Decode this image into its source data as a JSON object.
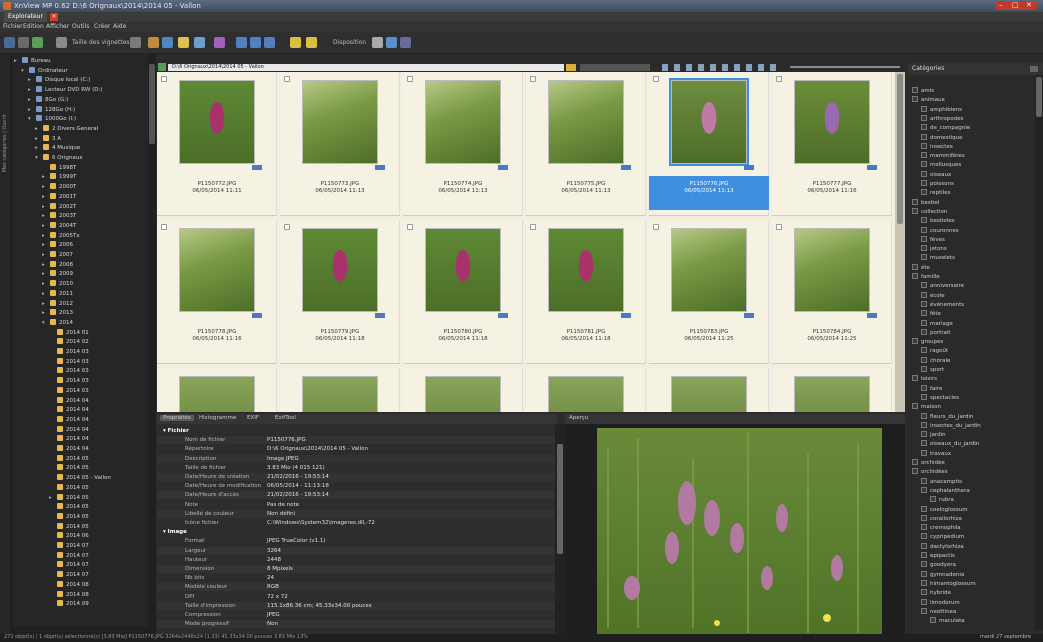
{
  "window": {
    "title": "XnView MP 0.62 D:\\6 Orignaux\\2014\\2014 05 - Vallon"
  },
  "tabs": [
    {
      "label": "Explorateur"
    }
  ],
  "menu": [
    "Fichier",
    "Edition",
    "Afficher",
    "Outils",
    "Créer",
    "Aide"
  ],
  "toolbar": {
    "thumb_size_label": "Taille des vignettes",
    "arrange_label": "Disposition"
  },
  "path": {
    "value": "D:\\6 Orignaux\\2014\\2014 05 - Vallon"
  },
  "side_strip": "Mes catégories | Ouvrir",
  "tree": [
    {
      "label": "Bureau",
      "indent": 0,
      "exp": "▸"
    },
    {
      "label": "Ordinateur",
      "indent": 1,
      "exp": "▾"
    },
    {
      "label": "Disque local (C:)",
      "indent": 2,
      "exp": "▸"
    },
    {
      "label": "Lecteur DVD RW (D:)",
      "indent": 2,
      "exp": "▸"
    },
    {
      "label": "8Go (G:)",
      "indent": 2,
      "exp": "▸"
    },
    {
      "label": "128Go (H:)",
      "indent": 2,
      "exp": "▸"
    },
    {
      "label": "1000Go (I:)",
      "indent": 2,
      "exp": "▾"
    },
    {
      "label": "2 Divers General",
      "indent": 3,
      "exp": "▸"
    },
    {
      "label": "3 A",
      "indent": 3,
      "exp": "▸"
    },
    {
      "label": "4 Musique",
      "indent": 3,
      "exp": "▸"
    },
    {
      "label": "6 Orignaux",
      "indent": 3,
      "exp": "▾"
    },
    {
      "label": "1998T",
      "indent": 4,
      "exp": ""
    },
    {
      "label": "1999T",
      "indent": 4,
      "exp": "▸"
    },
    {
      "label": "2000T",
      "indent": 4,
      "exp": "▸"
    },
    {
      "label": "2001T",
      "indent": 4,
      "exp": "▸"
    },
    {
      "label": "2002T",
      "indent": 4,
      "exp": "▸"
    },
    {
      "label": "2003T",
      "indent": 4,
      "exp": "▸"
    },
    {
      "label": "2004T",
      "indent": 4,
      "exp": "▸"
    },
    {
      "label": "2005Tx",
      "indent": 4,
      "exp": "▸"
    },
    {
      "label": "2006",
      "indent": 4,
      "exp": "▸"
    },
    {
      "label": "2007",
      "indent": 4,
      "exp": "▸"
    },
    {
      "label": "2008",
      "indent": 4,
      "exp": "▸"
    },
    {
      "label": "2009",
      "indent": 4,
      "exp": "▸"
    },
    {
      "label": "2010",
      "indent": 4,
      "exp": "▸"
    },
    {
      "label": "2011",
      "indent": 4,
      "exp": "▸"
    },
    {
      "label": "2012",
      "indent": 4,
      "exp": "▸"
    },
    {
      "label": "2013",
      "indent": 4,
      "exp": "▸"
    },
    {
      "label": "2014",
      "indent": 4,
      "exp": "▾"
    },
    {
      "label": "2014 01",
      "indent": 5,
      "exp": ""
    },
    {
      "label": "2014 02",
      "indent": 5,
      "exp": ""
    },
    {
      "label": "2014 03",
      "indent": 5,
      "exp": ""
    },
    {
      "label": "2014 03",
      "indent": 5,
      "exp": ""
    },
    {
      "label": "2014 03",
      "indent": 5,
      "exp": ""
    },
    {
      "label": "2014 03",
      "indent": 5,
      "exp": ""
    },
    {
      "label": "2014 03",
      "indent": 5,
      "exp": ""
    },
    {
      "label": "2014 04",
      "indent": 5,
      "exp": ""
    },
    {
      "label": "2014 04",
      "indent": 5,
      "exp": ""
    },
    {
      "label": "2014 04",
      "indent": 5,
      "exp": ""
    },
    {
      "label": "2014 04",
      "indent": 5,
      "exp": ""
    },
    {
      "label": "2014 04",
      "indent": 5,
      "exp": ""
    },
    {
      "label": "2014 04",
      "indent": 5,
      "exp": ""
    },
    {
      "label": "2014 05",
      "indent": 5,
      "exp": ""
    },
    {
      "label": "2014 05",
      "indent": 5,
      "exp": ""
    },
    {
      "label": "2014 05 - Vallon",
      "indent": 5,
      "exp": ""
    },
    {
      "label": "2014 05",
      "indent": 5,
      "exp": ""
    },
    {
      "label": "2014 05",
      "indent": 5,
      "exp": "▸"
    },
    {
      "label": "2014 05",
      "indent": 5,
      "exp": ""
    },
    {
      "label": "2014 05",
      "indent": 5,
      "exp": ""
    },
    {
      "label": "2014 05",
      "indent": 5,
      "exp": ""
    },
    {
      "label": "2014 06",
      "indent": 5,
      "exp": ""
    },
    {
      "label": "2014 07",
      "indent": 5,
      "exp": ""
    },
    {
      "label": "2014 07",
      "indent": 5,
      "exp": ""
    },
    {
      "label": "2014 07",
      "indent": 5,
      "exp": ""
    },
    {
      "label": "2014 07",
      "indent": 5,
      "exp": ""
    },
    {
      "label": "2014 08",
      "indent": 5,
      "exp": ""
    },
    {
      "label": "2014 08",
      "indent": 5,
      "exp": ""
    },
    {
      "label": "2014 09",
      "indent": 5,
      "exp": ""
    }
  ],
  "thumbnails": [
    {
      "name": "P1150772.JPG",
      "date": "06/05/2014 11:11",
      "selected": false,
      "palette": "orchid-dark"
    },
    {
      "name": "P1150773.JPG",
      "date": "06/05/2014 11:13",
      "selected": false,
      "palette": "meadow"
    },
    {
      "name": "P1150774.JPG",
      "date": "06/05/2014 11:13",
      "selected": false,
      "palette": "meadow"
    },
    {
      "name": "P1150775.JPG",
      "date": "06/05/2014 11:13",
      "selected": false,
      "palette": "meadow"
    },
    {
      "name": "P1150776.JPG",
      "date": "06/05/2014 11:13",
      "selected": true,
      "palette": "orchid-field"
    },
    {
      "name": "P1150777.JPG",
      "date": "06/05/2014 11:16",
      "selected": false,
      "palette": "orchid-light"
    },
    {
      "name": "P1150778.JPG",
      "date": "06/05/2014 11:16",
      "selected": false,
      "palette": "meadow"
    },
    {
      "name": "P1150779.JPG",
      "date": "06/05/2014 11:18",
      "selected": false,
      "palette": "orchid-dark"
    },
    {
      "name": "P1150780.JPG",
      "date": "06/05/2014 11:18",
      "selected": false,
      "palette": "orchid-dark"
    },
    {
      "name": "P1150781.JPG",
      "date": "06/05/2014 11:18",
      "selected": false,
      "palette": "orchid-dark"
    },
    {
      "name": "P1150783.JPG",
      "date": "06/05/2014 11:25",
      "selected": false,
      "palette": "meadow"
    },
    {
      "name": "P1150784.JPG",
      "date": "06/05/2014 11:25",
      "selected": false,
      "palette": "meadow"
    }
  ],
  "property_tabs": [
    "Propriétés",
    "Histogramme",
    "EXIF",
    "ExifTool"
  ],
  "properties": [
    {
      "k": "Fichier",
      "v": "",
      "sec": true
    },
    {
      "k": "Nom de fichier",
      "v": "P1150776.JPG"
    },
    {
      "k": "Répertoire",
      "v": "D:\\6 Orignaux\\2014\\2014 05 - Vallon"
    },
    {
      "k": "Description",
      "v": "Image JPEG"
    },
    {
      "k": "Taille de fichier",
      "v": "3.83 Mio (4 015 121)"
    },
    {
      "k": "Date/Heure de création",
      "v": "21/02/2016 - 19:53:14"
    },
    {
      "k": "Date/Heure de modification",
      "v": "06/05/2014 - 11:13:18"
    },
    {
      "k": "Date/Heure d'accès",
      "v": "21/02/2016 - 19:53:14"
    },
    {
      "k": "Note",
      "v": "Pas de note"
    },
    {
      "k": "Libellé de couleur",
      "v": "Non défini"
    },
    {
      "k": "Icône fichier",
      "v": "C:\\Windows\\System32\\imageres.dll,-72"
    },
    {
      "k": "Image",
      "v": "",
      "sec": true
    },
    {
      "k": "Format",
      "v": "JPEG TrueColor (v1.1)"
    },
    {
      "k": "Largeur",
      "v": "3264"
    },
    {
      "k": "Hauteur",
      "v": "2448"
    },
    {
      "k": "Dimension",
      "v": "8 Mpixels"
    },
    {
      "k": "Nb bits",
      "v": "24"
    },
    {
      "k": "Modèle couleur",
      "v": "RGB"
    },
    {
      "k": "DPI",
      "v": "72 x 72"
    },
    {
      "k": "Taille d'impression",
      "v": "115.1x86.36 cm; 45.33x34.00 pouces"
    },
    {
      "k": "Compression",
      "v": "JPEG"
    },
    {
      "k": "Mode progressif",
      "v": "Non"
    }
  ],
  "preview": {
    "title": "Aperçu"
  },
  "categories": {
    "title": "Catégories",
    "items": [
      {
        "label": "amis",
        "indent": 0
      },
      {
        "label": "animaux",
        "indent": 0
      },
      {
        "label": "amphibiens",
        "indent": 1
      },
      {
        "label": "arthropodes",
        "indent": 1
      },
      {
        "label": "de_compagnie",
        "indent": 1
      },
      {
        "label": "domestique",
        "indent": 1
      },
      {
        "label": "insectes",
        "indent": 1
      },
      {
        "label": "mammifères",
        "indent": 1
      },
      {
        "label": "mollusques",
        "indent": 1
      },
      {
        "label": "oiseaux",
        "indent": 1
      },
      {
        "label": "poissons",
        "indent": 1
      },
      {
        "label": "reptiles",
        "indent": 1
      },
      {
        "label": "bestiel",
        "indent": 0
      },
      {
        "label": "collection",
        "indent": 0
      },
      {
        "label": "bestioles",
        "indent": 1
      },
      {
        "label": "couronnes",
        "indent": 1
      },
      {
        "label": "fèves",
        "indent": 1
      },
      {
        "label": "jetons",
        "indent": 1
      },
      {
        "label": "muselets",
        "indent": 1
      },
      {
        "label": "éte",
        "indent": 0
      },
      {
        "label": "famille",
        "indent": 0
      },
      {
        "label": "anniversaire",
        "indent": 1
      },
      {
        "label": "école",
        "indent": 1
      },
      {
        "label": "événements",
        "indent": 1
      },
      {
        "label": "fête",
        "indent": 1
      },
      {
        "label": "mariage",
        "indent": 1
      },
      {
        "label": "portrait",
        "indent": 1
      },
      {
        "label": "groupes",
        "indent": 0
      },
      {
        "label": "ragoût",
        "indent": 1
      },
      {
        "label": "chorale",
        "indent": 1
      },
      {
        "label": "sport",
        "indent": 1
      },
      {
        "label": "loisirs",
        "indent": 0
      },
      {
        "label": "faire",
        "indent": 1
      },
      {
        "label": "spectacles",
        "indent": 1
      },
      {
        "label": "maison",
        "indent": 0
      },
      {
        "label": "fleurs_du_jardin",
        "indent": 1
      },
      {
        "label": "insectes_du_jardin",
        "indent": 1
      },
      {
        "label": "jardin",
        "indent": 1
      },
      {
        "label": "oiseaux_du_jardin",
        "indent": 1
      },
      {
        "label": "travaux",
        "indent": 1
      },
      {
        "label": "orchidée",
        "indent": 0
      },
      {
        "label": "orchidées",
        "indent": 0
      },
      {
        "label": "anacamptis",
        "indent": 1
      },
      {
        "label": "cephalanthera",
        "indent": 1
      },
      {
        "label": "rubra",
        "indent": 2
      },
      {
        "label": "coeloglossum",
        "indent": 1
      },
      {
        "label": "corallorhiza",
        "indent": 1
      },
      {
        "label": "cremophila",
        "indent": 1
      },
      {
        "label": "cypripedium",
        "indent": 1
      },
      {
        "label": "dactylorhiza",
        "indent": 1
      },
      {
        "label": "epipactis",
        "indent": 1
      },
      {
        "label": "goodyera",
        "indent": 1
      },
      {
        "label": "gymnadenia",
        "indent": 1
      },
      {
        "label": "himantoglossum",
        "indent": 1
      },
      {
        "label": "hybride",
        "indent": 1
      },
      {
        "label": "limodorum",
        "indent": 1
      },
      {
        "label": "neottinea",
        "indent": 1
      },
      {
        "label": "maculata",
        "indent": 2
      }
    ]
  },
  "status": {
    "text": "272 objet(s) / 1 objet(s) sélectionné(s) [3.83 Mio] P1150776.JPG 3264x2448x24 (1.33) 45.33x34.00 pouces 3.83 Mio 13%",
    "clock": "mardi 27 septembre"
  },
  "colors": {
    "accent": "#3f8fe0",
    "folder": "#e8b84a",
    "thumb_bg": "#f5f2e3"
  }
}
